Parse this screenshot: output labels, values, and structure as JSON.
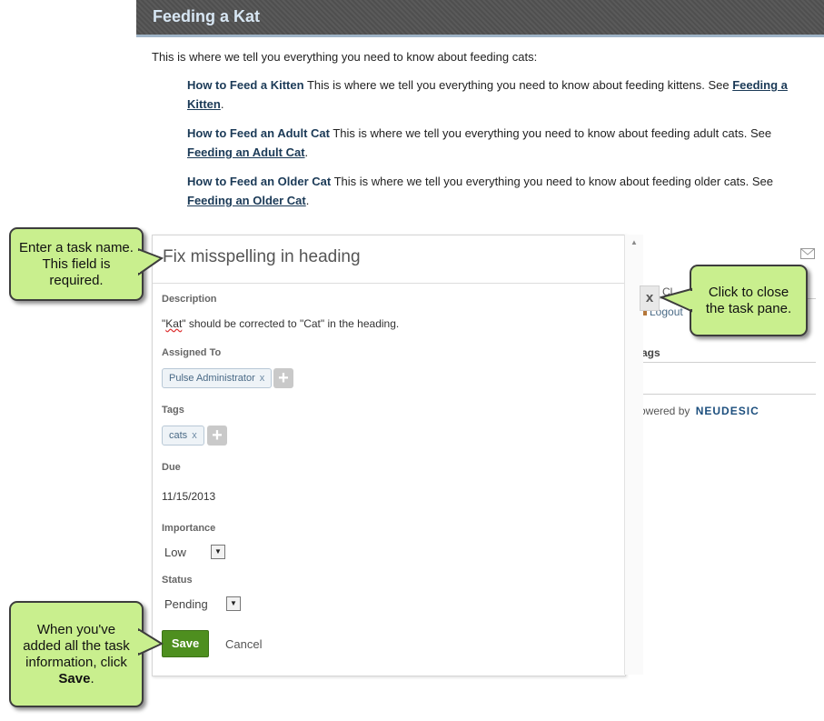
{
  "page": {
    "title": "Feeding a Kat",
    "intro": "This is where we tell you everything you need to know about feeding cats:"
  },
  "topics": [
    {
      "heading": "How to Feed a Kitten",
      "text": " This is where we tell you everything you need to know about feeding kittens. See ",
      "link": "Feeding a Kitten",
      "end": "."
    },
    {
      "heading": "How to Feed an Adult Cat",
      "text": " This is where we tell you everything you need to know about feeding adult cats. See ",
      "link": "Feeding an Adult Cat",
      "end": "."
    },
    {
      "heading": "How to Feed an Older Cat",
      "text": " This is where we tell you everything you need to know about feeding older cats. See ",
      "link": "Feeding an Older Cat",
      "end": "."
    }
  ],
  "side_panel": {
    "logout": "Logout",
    "tags_fragment": "ags",
    "powered_by": "owered by",
    "brand": "NEUDESIC",
    "partial_text": "Cl"
  },
  "task": {
    "name": "Fix misspelling in heading",
    "description_label": "Description",
    "description_pre": "\"",
    "description_misspelled": "Kat",
    "description_post": "\" should be corrected to \"Cat\" in the heading.",
    "assigned_label": "Assigned To",
    "assignee": "Pulse Administrator",
    "tags_label": "Tags",
    "tag": "cats",
    "remove_glyph": "x",
    "add_glyph": "+",
    "due_label": "Due",
    "due_value": "11/15/2013",
    "importance_label": "Importance",
    "importance_value": "Low",
    "status_label": "Status",
    "status_value": "Pending",
    "save_label": "Save",
    "cancel_label": "Cancel",
    "close_glyph": "x"
  },
  "callouts": {
    "task_name": [
      "Enter a task name.",
      "This field is",
      "required."
    ],
    "close": [
      "Click to close",
      "the task pane."
    ],
    "save_pre": [
      "When you've",
      "added all the task",
      "information, click"
    ],
    "save_bold": "Save",
    "save_end": "."
  },
  "colors": {
    "callout_fill": "#c9ef8e",
    "save_button": "#4e8f1f",
    "header_bg": "#555555",
    "link": "#1b3a57"
  },
  "icons": {
    "mail": "mail-icon",
    "scroll_up": "scroll-up-arrow-icon",
    "dropdown": "dropdown-arrow-icon"
  }
}
